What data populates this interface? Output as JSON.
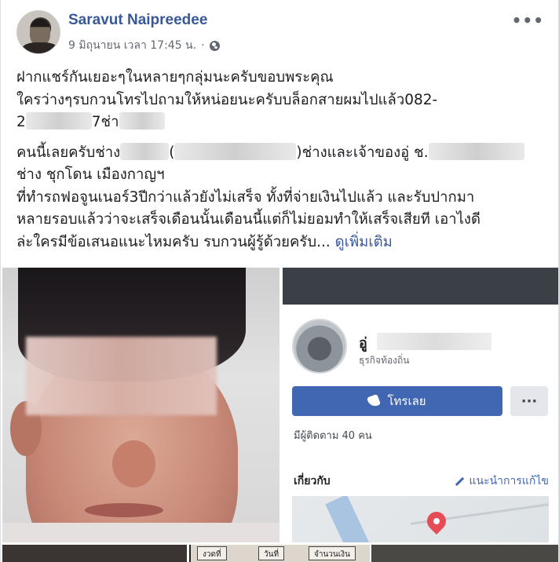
{
  "post": {
    "author": "Saravut Naipreedee",
    "timestamp": "9 มิถุนายน เวลา 17:45 น.",
    "text": {
      "line1": "ฝากแชร์กันเยอะๆในหลายๆกลุ่มนะครับขอบพระคุณ",
      "line2a": "ใครว่างๆรบกวนโทรไปถามให้หน่อยนะครับบล็อกสายผมไปแล้ว082-",
      "line3a": "2",
      "line3b": "7ช่า",
      "line4a": "คนนี้เลยครับช่าง",
      "line4b": "(",
      "line4c": ")ช่างและเจ้าของอู่ ช.",
      "line5": "ช่าง ชุกโดน เมืองกาญฯ",
      "line6": "ที่ทำรถฟอจูนเนอร์3ปีกว่าแล้วยังไม่เสร็จ ทั้งที่จ่ายเงินไปแล้ว และรับปากมา",
      "line7": "หลายรอบแล้วว่าจะเสร็จเดือนนั้นเดือนนี้แต่ก็ไม่ยอมทำให้เสร็จเสียที เอาไงดี",
      "line8": "ล่ะใครมีข้อเสนอแนะไหมครับ รบกวนผู้รู้ด้วยครับ...",
      "see_more": "ดูเพิ่มเติม"
    }
  },
  "screenshot_card": {
    "page_name_prefix": "อู่",
    "category": "ธุรกิจท้องถิ่น",
    "call_button": "โทรเลย",
    "more_button": "···",
    "followers": "มีผู้ติดตาม 40 คน",
    "about_title": "เกี่ยวกับ",
    "suggest_edit": "แนะนำการแก้ไข"
  },
  "bottom_doc": {
    "col1": "งวดที่",
    "col2": "วันที่",
    "col3": "จำนวนเงิน"
  },
  "icons": {
    "more": "more-options-icon",
    "globe": "globe-icon",
    "phone": "phone-icon",
    "pencil": "pencil-icon",
    "pin": "map-pin-icon"
  },
  "colors": {
    "author_link": "#385898",
    "call_button": "#4267b2",
    "map_pin": "#e64c56"
  }
}
